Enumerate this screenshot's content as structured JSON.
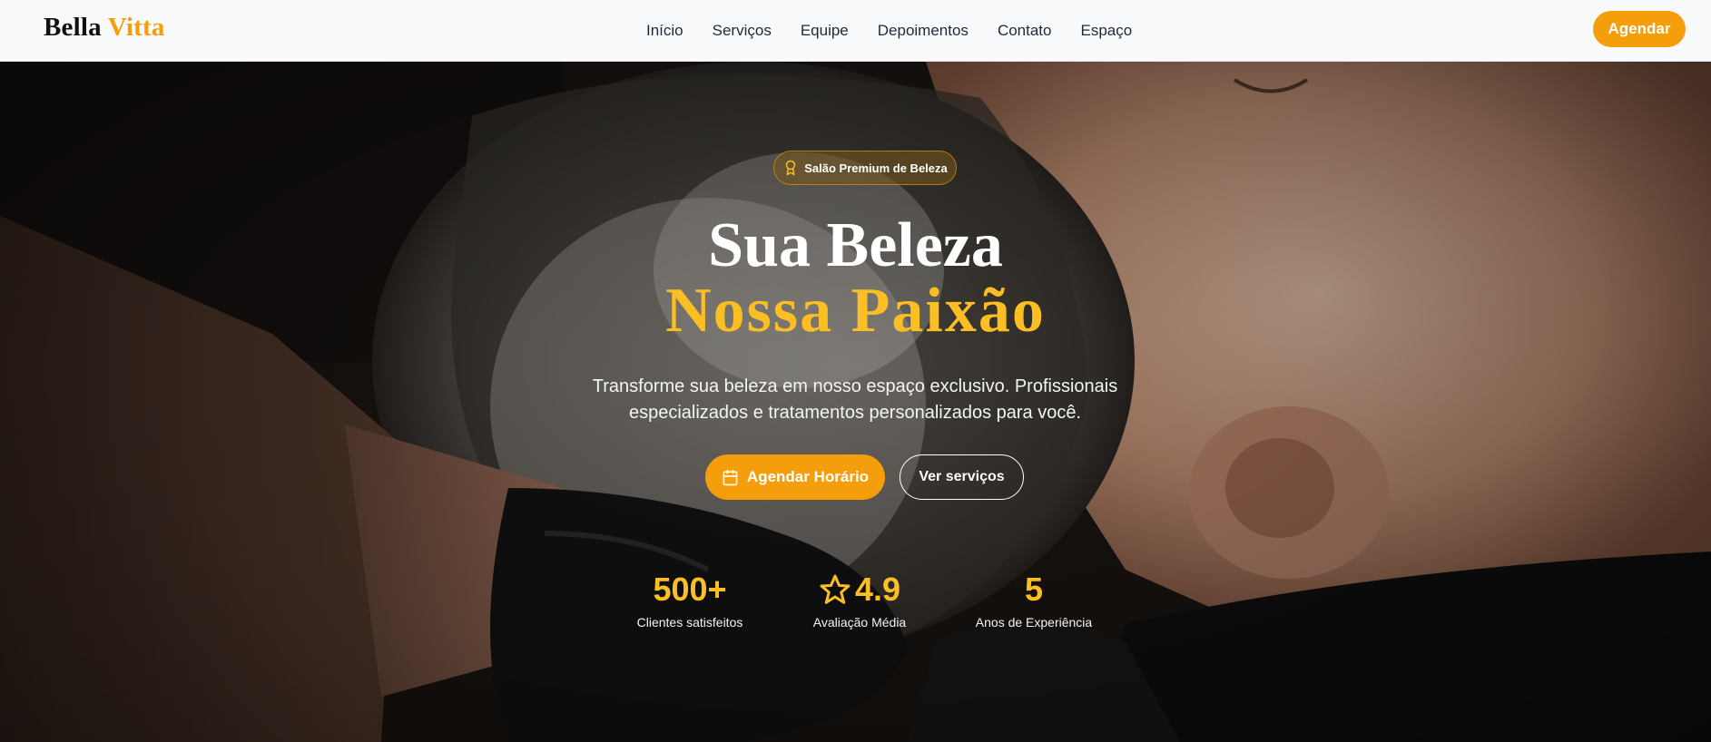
{
  "nav": {
    "brand_part1": "Bella",
    "brand_part2": "Vitta",
    "links": [
      "Início",
      "Serviços",
      "Equipe",
      "Depoimentos",
      "Contato",
      "Espaço"
    ],
    "cta": "Agendar"
  },
  "hero": {
    "badge": "Salão Premium de Beleza",
    "title_line1": "Sua Beleza",
    "title_line2": "Nossa Paixão",
    "subtitle": "Transforme sua beleza em nosso espaço exclusivo. Profissionais especializados e tratamentos personalizados para você.",
    "primary_button": "Agendar Horário",
    "secondary_button": "Ver serviços",
    "stats": [
      {
        "value": "500+",
        "label": "Clientes satisfeitos"
      },
      {
        "value": "4.9",
        "label": "Avaliação Média"
      },
      {
        "value": "5",
        "label": "Anos de Experiência"
      }
    ]
  },
  "icons": {
    "badge_icon": "award-icon",
    "primary_button_icon": "calendar-icon",
    "rating_icon": "star-icon"
  },
  "colors": {
    "accent": "#f59e0b",
    "accent_light": "#fbbf24",
    "nav_bg": "#f8fafc",
    "text_dark": "#1f2937"
  }
}
